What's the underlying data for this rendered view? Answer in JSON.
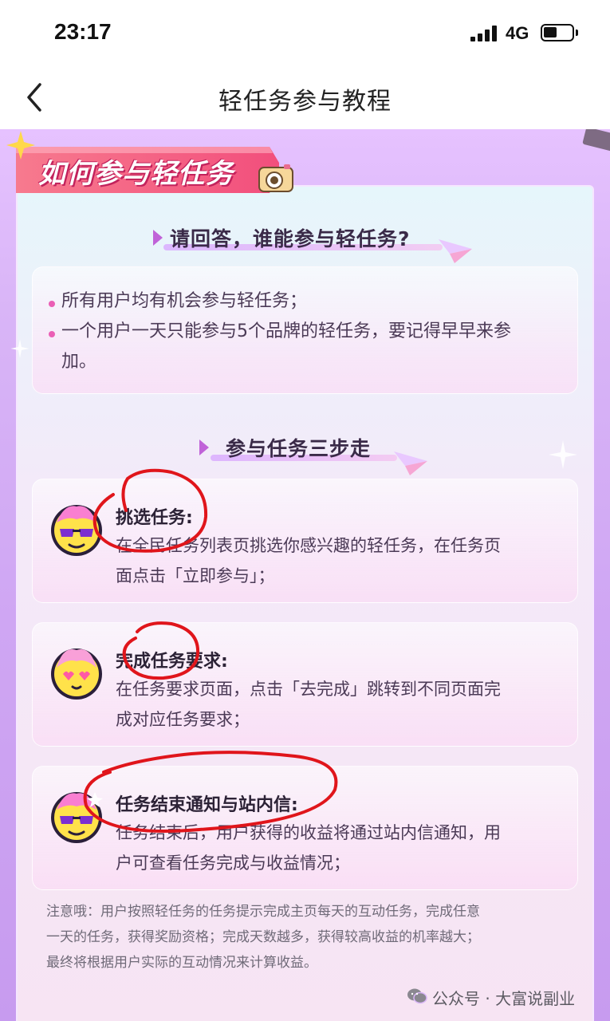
{
  "status_bar": {
    "time": "23:17",
    "network": "4G"
  },
  "nav": {
    "title": "轻任务参与教程"
  },
  "banner": {
    "title": "如何参与轻任务"
  },
  "section1": {
    "title": "请回答，谁能参与轻任务?",
    "lines": [
      "所有用户均有机会参与轻任务；",
      "一个用户一天只能参与5个品牌的轻任务，要记得早早来参",
      "加。"
    ]
  },
  "section2": {
    "title": "参与任务三步走"
  },
  "steps": [
    {
      "title": "挑选任务:",
      "desc_line1": "在全民任务列表页挑选你感兴趣的轻任务，在任务页",
      "desc_line2": "面点击「立即参与」；"
    },
    {
      "title": "完成任务要求:",
      "desc_line1": "在任务要求页面，点击「去完成」跳转到不同页面完",
      "desc_line2": "成对应任务要求；"
    },
    {
      "title": "任务结束通知与站内信:",
      "desc_line1": "任务结束后，用户获得的收益将通过站内信通知，用",
      "desc_line2": "户可查看任务完成与收益情况；"
    }
  ],
  "note": {
    "line1": "注意哦：用户按照轻任务的任务提示完成主页每天的互动任务，完成任意",
    "line2": "一天的任务，获得奖励资格；完成天数越多，获得较高收益的机率越大；",
    "line3": "最终将根据用户实际的互动情况来计算收益。"
  },
  "watermark": "公众号 · 大富说副业",
  "colors": {
    "accent": "#ea5fb5",
    "ribbon": "#f05a7e",
    "annotation": "#e0151b"
  }
}
